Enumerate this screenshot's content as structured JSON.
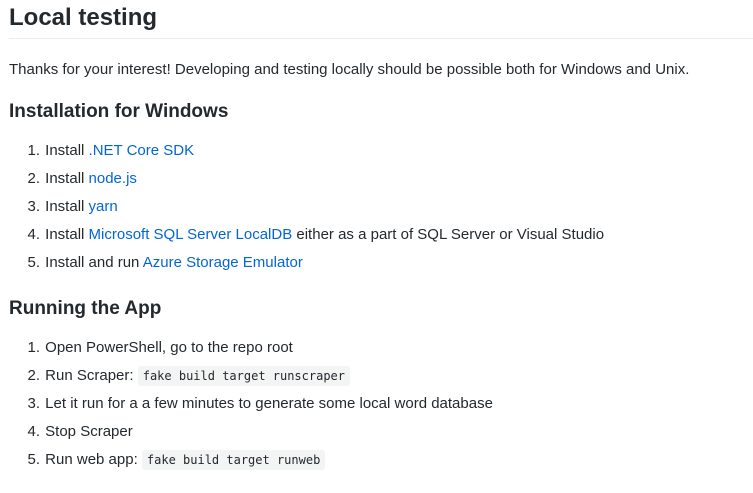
{
  "title": "Local testing",
  "intro": "Thanks for your interest! Developing and testing locally should be possible both for Windows and Unix.",
  "sections": [
    {
      "heading": "Installation for Windows",
      "items": [
        {
          "num": "1.",
          "pre": "Install ",
          "link": ".NET Core SDK",
          "post": ""
        },
        {
          "num": "2.",
          "pre": "Install ",
          "link": "node.js",
          "post": ""
        },
        {
          "num": "3.",
          "pre": "Install ",
          "link": "yarn",
          "post": ""
        },
        {
          "num": "4.",
          "pre": "Install ",
          "link": "Microsoft SQL Server LocalDB",
          "post": " either as a part of SQL Server or Visual Studio"
        },
        {
          "num": "5.",
          "pre": "Install and run ",
          "link": "Azure Storage Emulator",
          "post": ""
        }
      ]
    },
    {
      "heading": "Running the App",
      "items": [
        {
          "num": "1.",
          "text": "Open PowerShell, go to the repo root"
        },
        {
          "num": "2.",
          "text": "Run Scraper: ",
          "code": "fake build target runscraper"
        },
        {
          "num": "3.",
          "text": "Let it run for a a few minutes to generate some local word database"
        },
        {
          "num": "4.",
          "text": "Stop Scraper"
        },
        {
          "num": "5.",
          "text": "Run web app: ",
          "code": "fake build target runweb"
        }
      ]
    }
  ]
}
